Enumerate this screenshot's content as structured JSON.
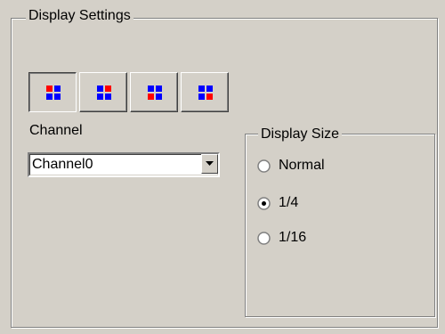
{
  "display_settings": {
    "title": "Display Settings",
    "layout_buttons": [
      {
        "name": "layout-1",
        "highlight": "top-left",
        "pressed": true
      },
      {
        "name": "layout-2",
        "highlight": "top-right",
        "pressed": false
      },
      {
        "name": "layout-3",
        "highlight": "bottom-left",
        "pressed": false
      },
      {
        "name": "layout-4",
        "highlight": "bottom-right",
        "pressed": false
      }
    ],
    "channel": {
      "label": "Channel",
      "selected": "Channel0"
    },
    "display_size": {
      "title": "Display Size",
      "options": [
        {
          "label": "Normal",
          "checked": false
        },
        {
          "label": "1/4",
          "checked": true
        },
        {
          "label": "1/16",
          "checked": false
        }
      ]
    }
  },
  "colors": {
    "face": "#d4d0c8",
    "red": "#ff0000",
    "blue": "#0000ff"
  }
}
